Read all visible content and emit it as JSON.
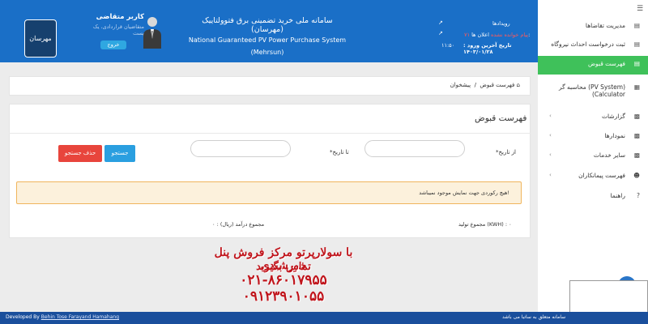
{
  "header": {
    "user_name": "کاربر متقاضی",
    "user_role": "متقاضیان قراردادی، یک پست",
    "logout_label": "خروج",
    "title_fa": "سامانه ملی خرید تضمینی برق فتوولتاییک (مهرسان)",
    "title_en": "National Guaranteed PV Power Purchase System (Mehrsun)",
    "events_label": "رویدادها",
    "notifications_label": "اعلان ها:",
    "notifications_count": "۷۱ پیام خوانده نشده",
    "last_login_label": "تاریخ آخرین ورود : ۱۴۰۳/۰۱/۲۸",
    "last_login_time": "۱۱:۵۰",
    "emblem_text": "مهرسان"
  },
  "sidebar": {
    "items": [
      {
        "label": "مدیریت تقاضاها",
        "icon": "list-icon",
        "chevron": false,
        "active": false
      },
      {
        "label": "ثبت درخواست احداث نیروگاه",
        "icon": "form-icon",
        "chevron": false,
        "active": false
      },
      {
        "label": "فهرست قبوض",
        "icon": "bill-icon",
        "chevron": false,
        "active": true
      },
      {
        "label": "محاسبه گر (PV System)",
        "label2": "(Calculator",
        "icon": "calculator-icon",
        "chevron": false,
        "active": false
      },
      {
        "label": "گزارشات",
        "icon": "chart-icon",
        "chevron": true,
        "active": false
      },
      {
        "label": "نمودارها",
        "icon": "chart-icon",
        "chevron": true,
        "active": false
      },
      {
        "label": "سایر خدمات",
        "icon": "chart-icon",
        "chevron": true,
        "active": false
      },
      {
        "label": "فهرست پیمانکاران",
        "icon": "users-icon",
        "chevron": true,
        "active": false
      },
      {
        "label": "راهنما",
        "icon": "help-icon",
        "chevron": false,
        "active": false
      }
    ]
  },
  "breadcrumb": {
    "home": "پیشخوان",
    "separator": "/",
    "current": "فهرست قبوض"
  },
  "panel": {
    "title": "فهرست قبوض",
    "from_date_label": "*از تاریخ",
    "to_date_label": "*تا تاریخ",
    "search_label": "جستجو",
    "clear_label": "حذف جستجو",
    "alert_text": "هیچ رکوردی جهت نمایش موجود نمیباشد!",
    "total_production": "مجموع تولید (KWH) : ۰",
    "total_income": "مجموع درآمد (ریال) : ۰"
  },
  "ad": {
    "line1": "با سولارپرتو مرکز فروش پنل خورشیدی",
    "line2": "تماس بگیرید",
    "line3": "۰۲۱-۸۶۰۱۷۹۵۵",
    "line4": "۰۹۱۲۳۹۰۱۰۵۵"
  },
  "footer": {
    "developed_by": "Developed By",
    "company": "Behin Tose Farayand Hamahang",
    "rights": "کلیه حقوق این سامانه متعلق به ساتبا می باشد ."
  },
  "colors": {
    "header_bg": "#1a6fc7",
    "active_menu": "#3fc15a",
    "search_button": "#2a9fe0",
    "clear_button": "#e8453c",
    "alert_bg": "#fcf1dc",
    "alert_border": "#f0b55d",
    "footer_bg": "#1a4f9c",
    "ad_text": "#c0141b"
  }
}
